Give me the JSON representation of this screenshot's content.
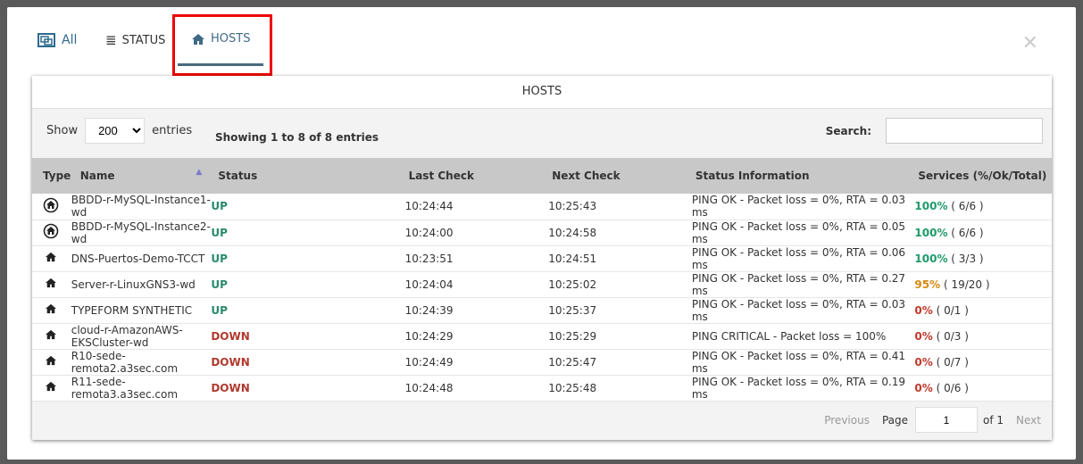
{
  "tabs": {
    "all": "All",
    "status": "STATUS",
    "hosts": "HOSTS"
  },
  "panel_title": "HOSTS",
  "show_label": "Show",
  "entries_label": "entries",
  "page_size": "200",
  "info": "Showing 1 to 8 of 8 entries",
  "search_label": "Search:",
  "search_value": "",
  "columns": [
    "Type",
    "Name",
    "Status",
    "Last Check",
    "Next Check",
    "Status Information",
    "Services (%/Ok/Total)"
  ],
  "rows": [
    {
      "icon": "circled-home",
      "name": "BBDD-r-MySQL-Instance1-wd",
      "status": "UP",
      "last": "10:24:44",
      "next": "10:25:43",
      "info": "PING OK - Packet loss = 0%, RTA = 0.03 ms",
      "pct": "100%",
      "count": "( 6/6 )",
      "level": "g"
    },
    {
      "icon": "circled-home",
      "name": "BBDD-r-MySQL-Instance2-wd",
      "status": "UP",
      "last": "10:24:00",
      "next": "10:24:58",
      "info": "PING OK - Packet loss = 0%, RTA = 0.05 ms",
      "pct": "100%",
      "count": "( 6/6 )",
      "level": "g"
    },
    {
      "icon": "home",
      "name": "DNS-Puertos-Demo-TCCT",
      "status": "UP",
      "last": "10:23:51",
      "next": "10:24:51",
      "info": "PING OK - Packet loss = 0%, RTA = 0.06 ms",
      "pct": "100%",
      "count": "( 3/3 )",
      "level": "g"
    },
    {
      "icon": "home",
      "name": "Server-r-LinuxGNS3-wd",
      "status": "UP",
      "last": "10:24:04",
      "next": "10:25:02",
      "info": "PING OK - Packet loss = 0%, RTA = 0.27 ms",
      "pct": "95%",
      "count": "( 19/20 )",
      "level": "o"
    },
    {
      "icon": "home",
      "name": "TYPEFORM SYNTHETIC",
      "status": "UP",
      "last": "10:24:39",
      "next": "10:25:37",
      "info": "PING OK - Packet loss = 0%, RTA = 0.03 ms",
      "pct": "0%",
      "count": "( 0/1 )",
      "level": "r"
    },
    {
      "icon": "home",
      "name": "cloud-r-AmazonAWS-EKSCluster-wd",
      "status": "DOWN",
      "last": "10:24:29",
      "next": "10:25:29",
      "info": "PING CRITICAL - Packet loss = 100%",
      "pct": "0%",
      "count": "( 0/3 )",
      "level": "r"
    },
    {
      "icon": "home",
      "name": "R10-sede-remota2.a3sec.com",
      "status": "DOWN",
      "last": "10:24:49",
      "next": "10:25:47",
      "info": "PING OK - Packet loss = 0%, RTA = 0.41 ms",
      "pct": "0%",
      "count": "( 0/7 )",
      "level": "r"
    },
    {
      "icon": "home",
      "name": "R11-sede-remota3.a3sec.com",
      "status": "DOWN",
      "last": "10:24:48",
      "next": "10:25:48",
      "info": "PING OK - Packet loss = 0%, RTA = 0.19 ms",
      "pct": "0%",
      "count": "( 0/6 )",
      "level": "r"
    }
  ],
  "pager": {
    "previous": "Previous",
    "page": "Page",
    "current": "1",
    "of": "of 1",
    "next": "Next"
  }
}
